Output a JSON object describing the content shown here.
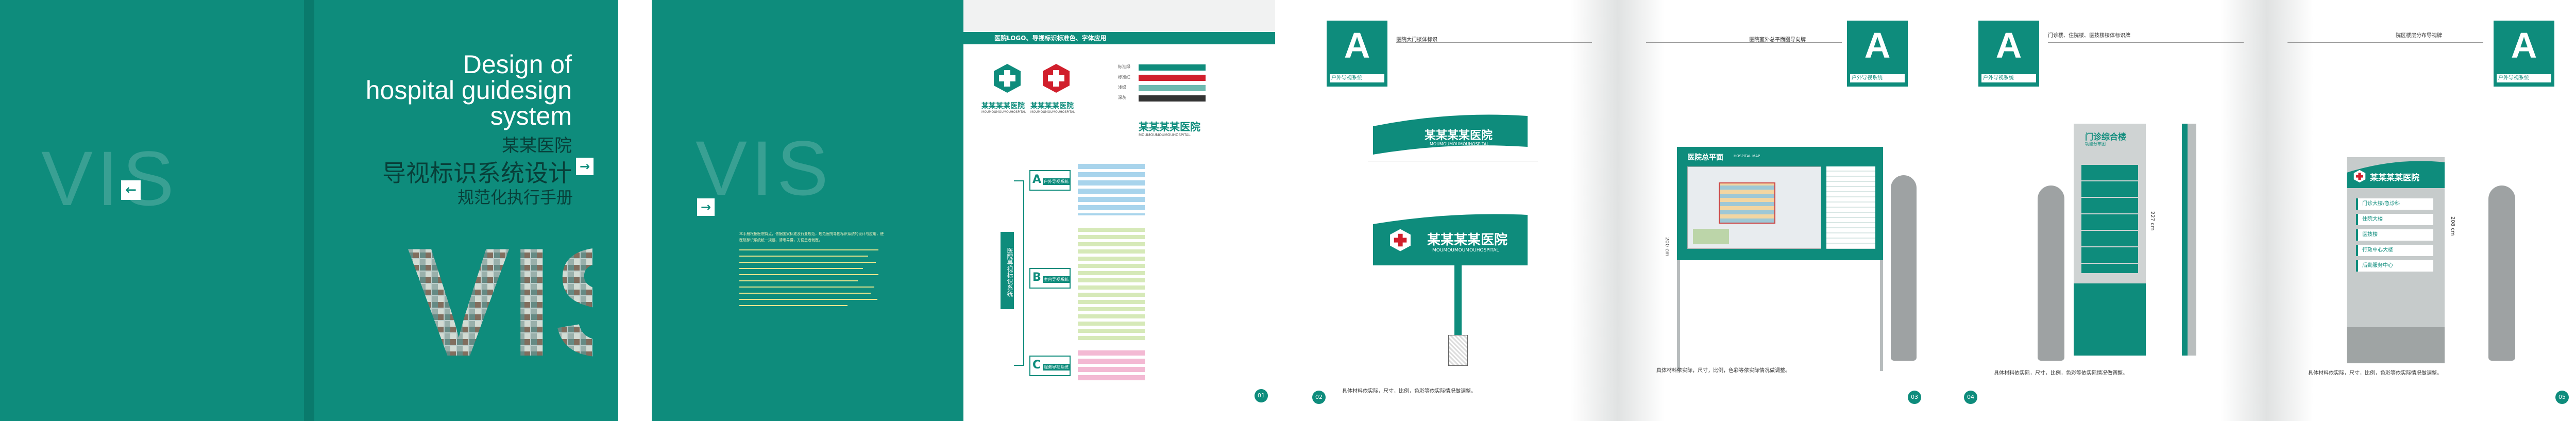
{
  "cover": {
    "title_en_1": "Design of",
    "title_en_2": "hospital guidesign",
    "title_en_3": "system",
    "hospital_name": "某某医院",
    "main_title": "导视标识系统设计",
    "subtitle": "规范化执行手册",
    "vis_letters": "VIS",
    "arrow": "←",
    "arrow2": "→"
  },
  "intro": {
    "vis_letters": "VIS",
    "arrow": "→",
    "body_text": "本手册根据医院特点，依据国家标准及行业规范，规范医院导视标识系统的设计与应用，使医院标识系统统一规范、清晰易懂，方便患者就医。"
  },
  "logo_page": {
    "header": "医院LOGO、导视标识标准色、字体应用",
    "logo_name": "某某某某医院",
    "logo_name_en": "MOUMOUMOUMOUHOSPITAL",
    "wordmark": "某某某某医院",
    "wordmark_en": "MOUMOUMOUMOUHOSPITAL",
    "colors": [
      {
        "name": "标准绿",
        "hex": "#0e8c7c"
      },
      {
        "name": "标准红",
        "hex": "#d11f2c"
      },
      {
        "name": "浅绿",
        "hex": "#7bc9b6"
      },
      {
        "name": "深灰",
        "hex": "#333333"
      }
    ],
    "tree_root": "医院导视标识系统",
    "branches": [
      {
        "letter": "A",
        "label": "户外导视系统",
        "color": "#0e8c7c"
      },
      {
        "letter": "B",
        "label": "室内导视系统",
        "color": "#0e8c7c"
      },
      {
        "letter": "C",
        "label": "服务导视系统",
        "color": "#0e8c7c"
      }
    ],
    "page_number": "01"
  },
  "spread_a": {
    "badge_letter": "A",
    "badge_sub": "户外导视系统",
    "left_header": "医院大门楼体标识",
    "right_header": "医院室外总平面图导向牌",
    "sign_name": "某某某某医院",
    "sign_name_en": "MOUMOUMOUMOUHOSPITAL",
    "map_title": "医院总平面",
    "map_title_en": "HOSPITAL MAP",
    "height_label": "200 cm",
    "note_left": "具体材料依实际，尺寸，比例，色彩等依实际情况做调整。",
    "note_right": "具体材料依实际，尺寸，比例，色彩等依实际情况做调整。",
    "page_left": "02",
    "page_right": "03"
  },
  "spread_b": {
    "badge_letter": "A",
    "badge_sub": "户外导视系统",
    "left_header": "门诊楼、住院楼、医技楼楼体标识牌",
    "right_header": "院区楼层分布导视牌",
    "building_title": "门诊综合楼",
    "building_sub": "功能分布图",
    "height_label": "227 cm",
    "height_label2": "208 cm",
    "sign_name": "某某某某医院",
    "direction_items": [
      "门诊大楼/急诊科",
      "住院大楼",
      "医技楼",
      "行政中心大楼",
      "后勤服务中心"
    ],
    "note_left": "具体材料依实际，尺寸，比例，色彩等依实际情况做调整。",
    "note_right": "具体材料依实际，尺寸，比例，色彩等依实际情况做调整。",
    "page_left": "04",
    "page_right": "05"
  }
}
